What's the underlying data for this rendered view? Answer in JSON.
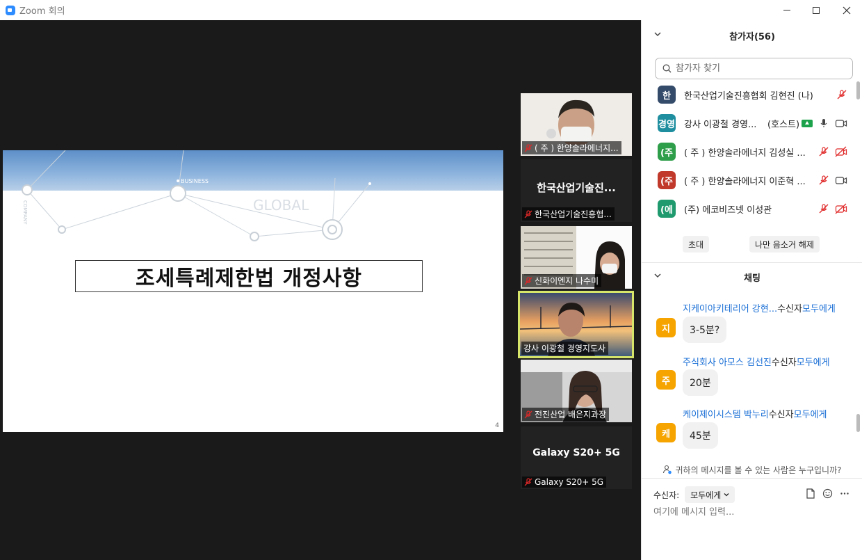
{
  "window": {
    "title": "Zoom 회의"
  },
  "slide": {
    "business_label": "BUSINESS",
    "global_label": "GLOBAL",
    "company_label": "COMPANY",
    "title": "조세특례제한법 개정사항",
    "page_number": "4"
  },
  "thumbnails": [
    {
      "label": "( 주 ) 한양솔라에너지...",
      "center": "",
      "muted": true
    },
    {
      "label": "한국산업기술진흥협...",
      "center": "한국산업기술진...",
      "muted": true
    },
    {
      "label": "신화이엔지 나수미",
      "center": "",
      "muted": true
    },
    {
      "label": "강사 이광철 경영지도사",
      "center": "",
      "muted": false
    },
    {
      "label": "전진산업 배은지과장",
      "center": "",
      "muted": true
    },
    {
      "label": "Galaxy S20+ 5G",
      "center": "Galaxy S20+ 5G",
      "muted": true
    }
  ],
  "participants": {
    "header": "참가자(56)",
    "search_placeholder": "참가자 찾기",
    "list": [
      {
        "initial": "한",
        "name": "한국산업기술진흥협회 김현진 (나)",
        "color": "#344b6a"
      },
      {
        "initial": "경영",
        "name": "강사 이광철 경영...",
        "host": "(호스트)",
        "color": "#1f8fa0"
      },
      {
        "initial": "(주",
        "name": "( 주 ) 한양솔라에너지 김성실 ...",
        "color": "#2e9e4a"
      },
      {
        "initial": "(주",
        "name": "( 주 ) 한양솔라에너지 이준혁 ...",
        "color": "#c0392b"
      },
      {
        "initial": "(에",
        "name": "(주) 에코비즈넷 이성관",
        "color": "#1f9a6e"
      }
    ],
    "invite_label": "초대",
    "unmute_me_label": "나만 음소거 해제"
  },
  "chat": {
    "header": "채팅",
    "to_word": "수신자",
    "everyone_word": "모두에게",
    "messages": [
      {
        "initial": "지",
        "sender": "지케이아키테리어 강현...",
        "text": "3-5분?"
      },
      {
        "initial": "주",
        "sender": "주식회사 아모스 김선진",
        "text": "20분"
      },
      {
        "initial": "케",
        "sender": "케이제이시스템 박누리",
        "text": "45분"
      }
    ],
    "privacy_note": "귀하의 메시지를 볼 수 있는 사람은 누구입니까?",
    "to_label": "수신자:",
    "to_value": "모두에게",
    "input_placeholder": "여기에 메시지 입력..."
  },
  "colors": {
    "stage_bg": "#1a1a1a",
    "link_blue": "#1a6fd6",
    "mute_red": "#e02828",
    "chat_avatar": "#f6a400",
    "active_speaker": "#d7e56a"
  }
}
